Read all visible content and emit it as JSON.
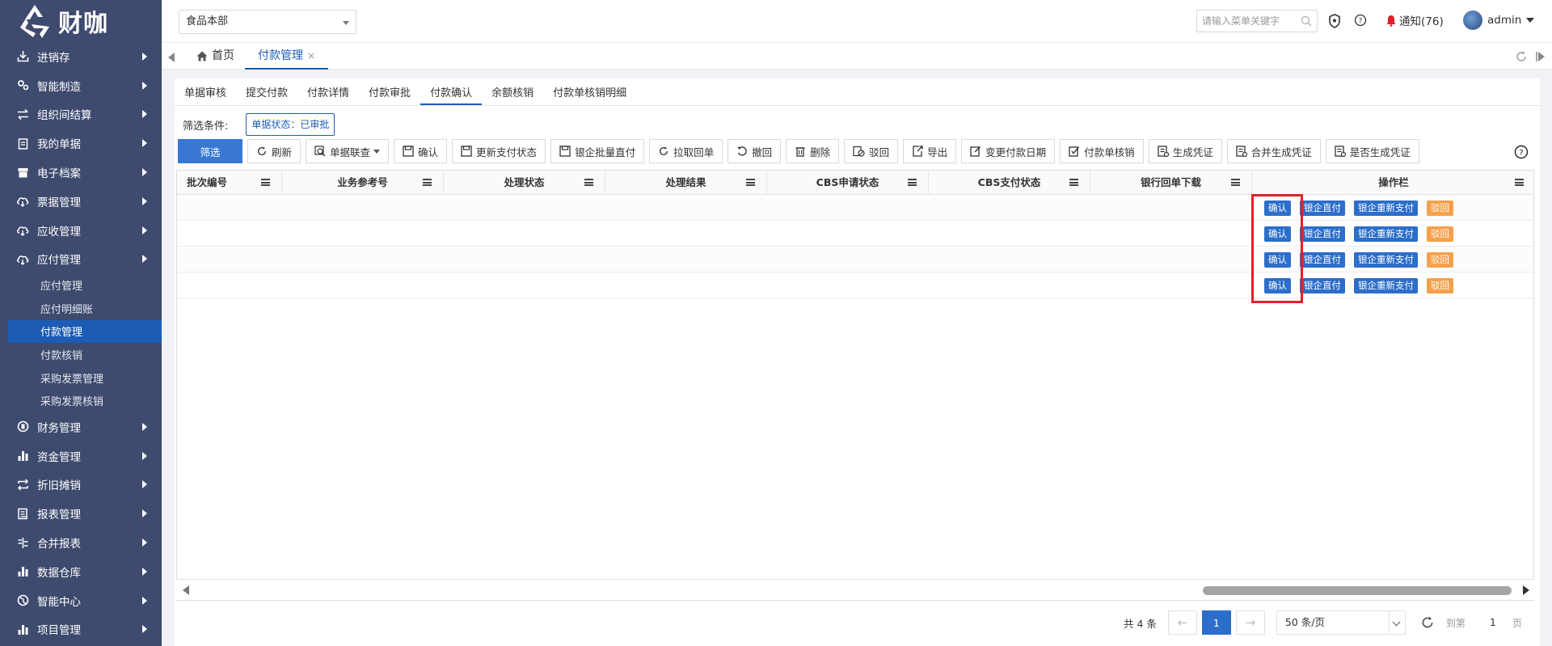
{
  "brand": {
    "name": "财咖"
  },
  "sidebar": {
    "items": [
      {
        "label": "进销存",
        "icon": "download-icon"
      },
      {
        "label": "智能制造",
        "icon": "gears-icon"
      },
      {
        "label": "组织间结算",
        "icon": "swap-icon"
      },
      {
        "label": "我的单据",
        "icon": "clipboard-icon"
      },
      {
        "label": "电子档案",
        "icon": "archive-icon"
      },
      {
        "label": "票据管理",
        "icon": "cloud-icon"
      },
      {
        "label": "应收管理",
        "icon": "cloud-icon"
      },
      {
        "label": "应付管理",
        "icon": "cloud-icon"
      }
    ],
    "sub_items": [
      {
        "label": "应付管理",
        "active": false
      },
      {
        "label": "应付明细账",
        "active": false
      },
      {
        "label": "付款管理",
        "active": true
      },
      {
        "label": "付款核销",
        "active": false
      },
      {
        "label": "采购发票管理",
        "active": false
      },
      {
        "label": "采购发票核销",
        "active": false
      }
    ],
    "items_after": [
      {
        "label": "财务管理",
        "icon": "coin-icon"
      },
      {
        "label": "资金管理",
        "icon": "bar-chart-icon"
      },
      {
        "label": "折旧摊销",
        "icon": "repeat-icon"
      },
      {
        "label": "报表管理",
        "icon": "report-icon"
      },
      {
        "label": "合并报表",
        "icon": "merge-icon"
      },
      {
        "label": "数据仓库",
        "icon": "bar-chart-icon"
      },
      {
        "label": "智能中心",
        "icon": "globe-icon"
      },
      {
        "label": "项目管理",
        "icon": "bar-chart-icon"
      }
    ]
  },
  "header": {
    "company": "食品本部",
    "search_placeholder": "请输入菜单关键字",
    "notify_label": "通知(76)",
    "user": "admin"
  },
  "tabs": {
    "home": "首页",
    "active": "付款管理",
    "close": "×"
  },
  "subtabs": [
    "单据审核",
    "提交付款",
    "付款详情",
    "付款审批",
    "付款确认",
    "余额核销",
    "付款单核销明细"
  ],
  "subtab_active_index": 4,
  "filter": {
    "label": "筛选条件:",
    "chip": "单据状态：已审批"
  },
  "toolbar": {
    "primary": "筛选",
    "buttons": [
      "刷新",
      "单据联查",
      "确认",
      "更新支付状态",
      "银企批量直付",
      "拉取回单",
      "撤回",
      "删除",
      "驳回",
      "导出",
      "变更付款日期",
      "付款单核销",
      "生成凭证",
      "合并生成凭证",
      "是否生成凭证"
    ]
  },
  "grid": {
    "columns": [
      "批次编号",
      "业务参考号",
      "处理状态",
      "处理结果",
      "CBS申请状态",
      "CBS支付状态",
      "银行回单下载",
      "操作栏"
    ],
    "row_actions": [
      "确认",
      "银企直付",
      "银企重新支付",
      "驳回"
    ],
    "row_count": 4
  },
  "pager": {
    "total": "共 4 条",
    "current": "1",
    "page_size": "50 条/页",
    "goto_label": "到第",
    "goto_value": "1",
    "page_suffix": "页"
  },
  "colors": {
    "sidebar_bg": "#3e4a6e",
    "accent": "#1c5cb4",
    "action_blue": "#2c6ec9",
    "action_orange": "#f5a04a",
    "highlight_red": "#e0202a"
  }
}
